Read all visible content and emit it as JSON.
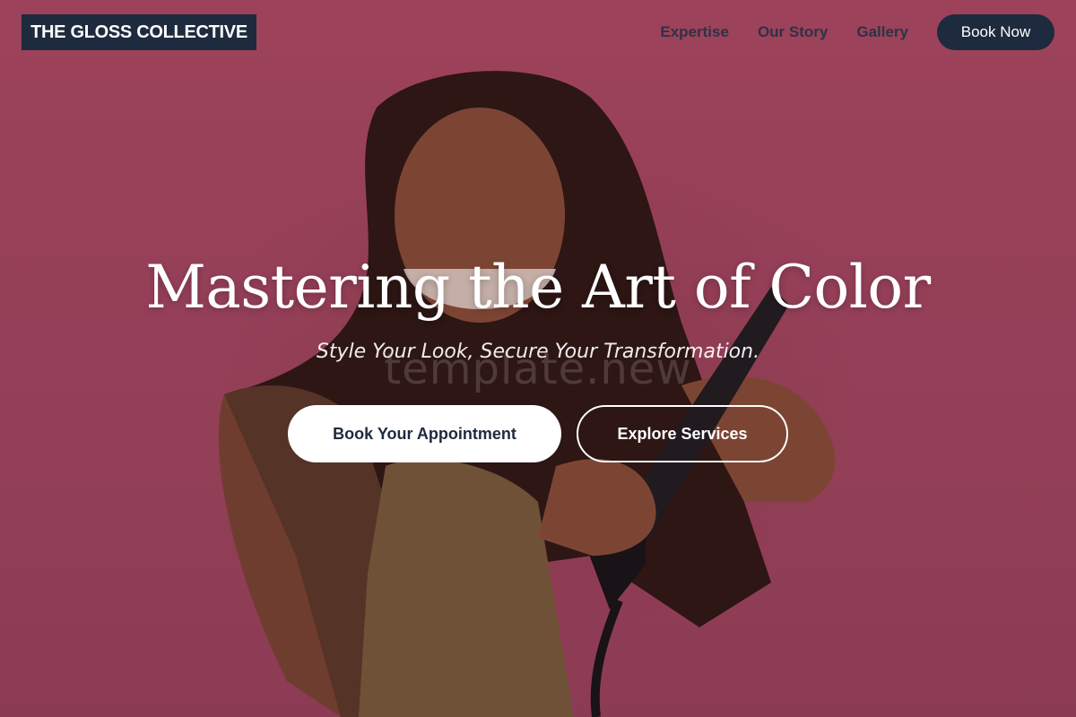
{
  "brand": {
    "name": "THE GLOSS COLLECTIVE"
  },
  "nav": {
    "items": [
      {
        "label": "Expertise"
      },
      {
        "label": "Our Story"
      },
      {
        "label": "Gallery"
      }
    ],
    "book_now_label": "Book Now"
  },
  "hero": {
    "headline": "Mastering the Art of Color",
    "subheadline": "Style Your Look, Secure Your Transformation.",
    "watermark": "template.new",
    "primary_cta": "Book Your Appointment",
    "secondary_cta": "Explore Services",
    "image": "woman-straightening-hair-photo"
  },
  "colors": {
    "background": "#a84a64",
    "navy": "#1e2a3d",
    "white": "#ffffff"
  }
}
